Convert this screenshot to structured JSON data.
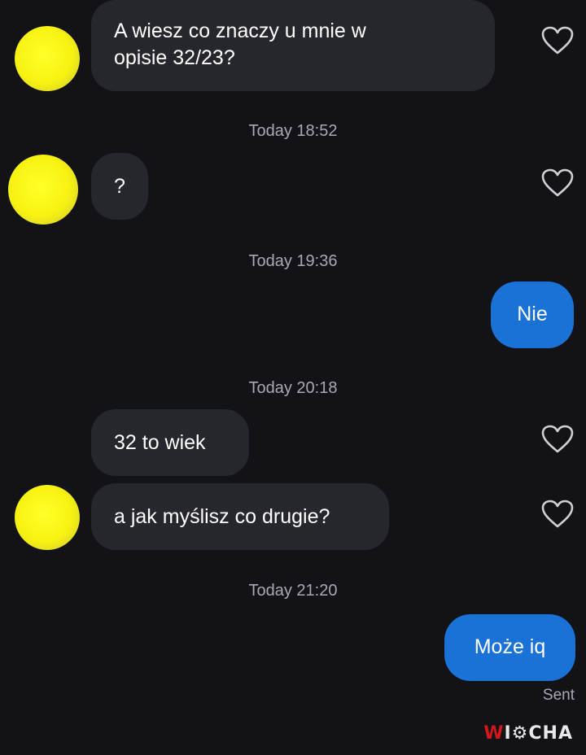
{
  "messages": [
    {
      "text": "A wiesz co znaczy u mnie w\nopisie 32/23?"
    },
    {
      "text": "?"
    },
    {
      "text": "Nie"
    },
    {
      "text": "32 to wiek"
    },
    {
      "text": "a jak myślisz co drugie?"
    },
    {
      "text": "Może iq"
    }
  ],
  "timestamps": [
    "Today 18:52",
    "Today 19:36",
    "Today 20:18",
    "Today 21:20"
  ],
  "status": "Sent",
  "watermark": {
    "first": "W",
    "rest": "I⚙CHA"
  },
  "icons": {
    "like": "heart-outline-icon",
    "avatar": "contact-avatar-redacted"
  },
  "colors": {
    "background": "#121217",
    "incoming": "#26262d",
    "outgoing": "#1a72d6",
    "avatar": "#f7f211"
  }
}
